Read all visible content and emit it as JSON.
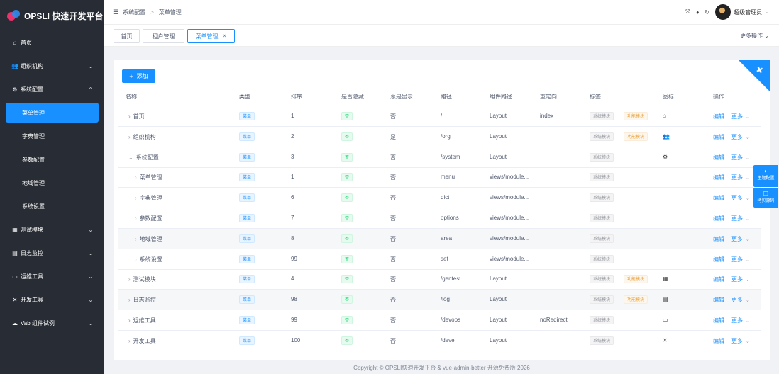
{
  "app": {
    "title": "OPSLI 快速开发平台"
  },
  "sidebar": {
    "items": [
      {
        "label": "首页",
        "icon": "home-icon",
        "glyph": "⌂",
        "expandable": false
      },
      {
        "label": "组织机构",
        "icon": "users-icon",
        "glyph": "👥",
        "expandable": true,
        "expanded": false
      },
      {
        "label": "系统配置",
        "icon": "gear-icon",
        "glyph": "⚙",
        "expandable": true,
        "expanded": true,
        "children": [
          "菜单管理",
          "字典管理",
          "参数配置",
          "地域管理",
          "系统设置"
        ],
        "active_child": 0
      },
      {
        "label": "测试模块",
        "icon": "box-icon",
        "glyph": "▦",
        "expandable": true,
        "expanded": false
      },
      {
        "label": "日志监控",
        "icon": "file-icon",
        "glyph": "▤",
        "expandable": true,
        "expanded": false
      },
      {
        "label": "运维工具",
        "icon": "monitor-icon",
        "glyph": "▭",
        "expandable": true,
        "expanded": false
      },
      {
        "label": "开发工具",
        "icon": "tools-icon",
        "glyph": "✕",
        "expandable": true,
        "expanded": false
      },
      {
        "label": "Vab 组件试例",
        "icon": "cloud-icon",
        "glyph": "☁",
        "expandable": true,
        "expanded": false
      }
    ]
  },
  "header": {
    "breadcrumb": [
      "系统配置",
      "菜单管理"
    ],
    "username": "超级管理员",
    "icons": [
      "fullscreen-icon",
      "theme-icon",
      "refresh-icon"
    ]
  },
  "tabs": {
    "items": [
      {
        "label": "首页",
        "active": false,
        "closable": false
      },
      {
        "label": "租户管理",
        "active": false,
        "closable": false
      },
      {
        "label": "菜单管理",
        "active": true,
        "closable": true
      }
    ],
    "more_label": "更多操作"
  },
  "toolbar": {
    "add_label": "添加"
  },
  "table": {
    "columns": [
      "名称",
      "类型",
      "排序",
      "是否隐藏",
      "总是显示",
      "路径",
      "组件路径",
      "重定向",
      "标签",
      "图标",
      "操作"
    ],
    "rows": [
      {
        "name": "首页",
        "level": 0,
        "arrow": "›",
        "type": "菜单",
        "sort": "1",
        "hidden": "否",
        "always": "否",
        "path": "/",
        "component": "Layout",
        "redirect": "index",
        "tags": [
          "系统模块",
          "功能模块"
        ],
        "icon": "home-icon",
        "glyph": "⌂"
      },
      {
        "name": "组织机构",
        "level": 0,
        "arrow": "›",
        "type": "菜单",
        "sort": "2",
        "hidden": "否",
        "always": "是",
        "path": "/org",
        "component": "Layout",
        "redirect": "",
        "tags": [
          "系统模块",
          "功能模块"
        ],
        "icon": "users-icon",
        "glyph": "👥"
      },
      {
        "name": "系统配置",
        "level": 0,
        "arrow": "⌄",
        "type": "菜单",
        "sort": "3",
        "hidden": "否",
        "always": "否",
        "path": "/system",
        "component": "Layout",
        "redirect": "",
        "tags": [
          "系统模块"
        ],
        "icon": "gear-icon",
        "glyph": "⚙"
      },
      {
        "name": "菜单管理",
        "level": 1,
        "arrow": "›",
        "type": "菜单",
        "sort": "1",
        "hidden": "否",
        "always": "否",
        "path": "menu",
        "component": "views/module...",
        "redirect": "",
        "tags": [
          "系统模块"
        ],
        "icon": "",
        "glyph": ""
      },
      {
        "name": "字典管理",
        "level": 1,
        "arrow": "›",
        "type": "菜单",
        "sort": "6",
        "hidden": "否",
        "always": "否",
        "path": "dict",
        "component": "views/module...",
        "redirect": "",
        "tags": [
          "系统模块"
        ],
        "icon": "",
        "glyph": ""
      },
      {
        "name": "参数配置",
        "level": 1,
        "arrow": "›",
        "type": "菜单",
        "sort": "7",
        "hidden": "否",
        "always": "否",
        "path": "options",
        "component": "views/module...",
        "redirect": "",
        "tags": [
          "系统模块"
        ],
        "icon": "",
        "glyph": ""
      },
      {
        "name": "地域管理",
        "level": 1,
        "arrow": "›",
        "type": "菜单",
        "sort": "8",
        "hidden": "否",
        "always": "否",
        "path": "area",
        "component": "views/module...",
        "redirect": "",
        "tags": [
          "系统模块"
        ],
        "icon": "",
        "glyph": ""
      },
      {
        "name": "系统设置",
        "level": 1,
        "arrow": "›",
        "type": "菜单",
        "sort": "99",
        "hidden": "否",
        "always": "否",
        "path": "set",
        "component": "views/module...",
        "redirect": "",
        "tags": [
          "系统模块"
        ],
        "icon": "",
        "glyph": ""
      },
      {
        "name": "测试模块",
        "level": 0,
        "arrow": "›",
        "type": "菜单",
        "sort": "4",
        "hidden": "否",
        "always": "否",
        "path": "/gentest",
        "component": "Layout",
        "redirect": "",
        "tags": [
          "系统模块",
          "功能模块"
        ],
        "icon": "box-icon",
        "glyph": "▦"
      },
      {
        "name": "日志监控",
        "level": 0,
        "arrow": "›",
        "type": "菜单",
        "sort": "98",
        "hidden": "否",
        "always": "否",
        "path": "/log",
        "component": "Layout",
        "redirect": "",
        "tags": [
          "系统模块",
          "功能模块"
        ],
        "icon": "file-icon",
        "glyph": "▤"
      },
      {
        "name": "运维工具",
        "level": 0,
        "arrow": "›",
        "type": "菜单",
        "sort": "99",
        "hidden": "否",
        "always": "否",
        "path": "/devops",
        "component": "Layout",
        "redirect": "noRedirect",
        "tags": [
          "系统模块"
        ],
        "icon": "monitor-icon",
        "glyph": "▭"
      },
      {
        "name": "开发工具",
        "level": 0,
        "arrow": "›",
        "type": "菜单",
        "sort": "100",
        "hidden": "否",
        "always": "否",
        "path": "/deve",
        "component": "Layout",
        "redirect": "",
        "tags": [
          "系统模块"
        ],
        "icon": "tools-icon",
        "glyph": "✕"
      }
    ],
    "edit_label": "编辑",
    "more_label": "更多"
  },
  "float_buttons": [
    {
      "label": "主题配置",
      "icon": "palette-icon",
      "glyph": "◐"
    },
    {
      "label": "拷贝源码",
      "icon": "copy-icon",
      "glyph": "❐"
    }
  ],
  "footer": {
    "text": "Copyright © OPSLI快速开发平台 & vue-admin-better 开源免费版 2026"
  },
  "colors": {
    "primary": "#1890ff",
    "sidebar": "#282c34",
    "success": "#13ce66",
    "warning": "#e6a23c"
  }
}
